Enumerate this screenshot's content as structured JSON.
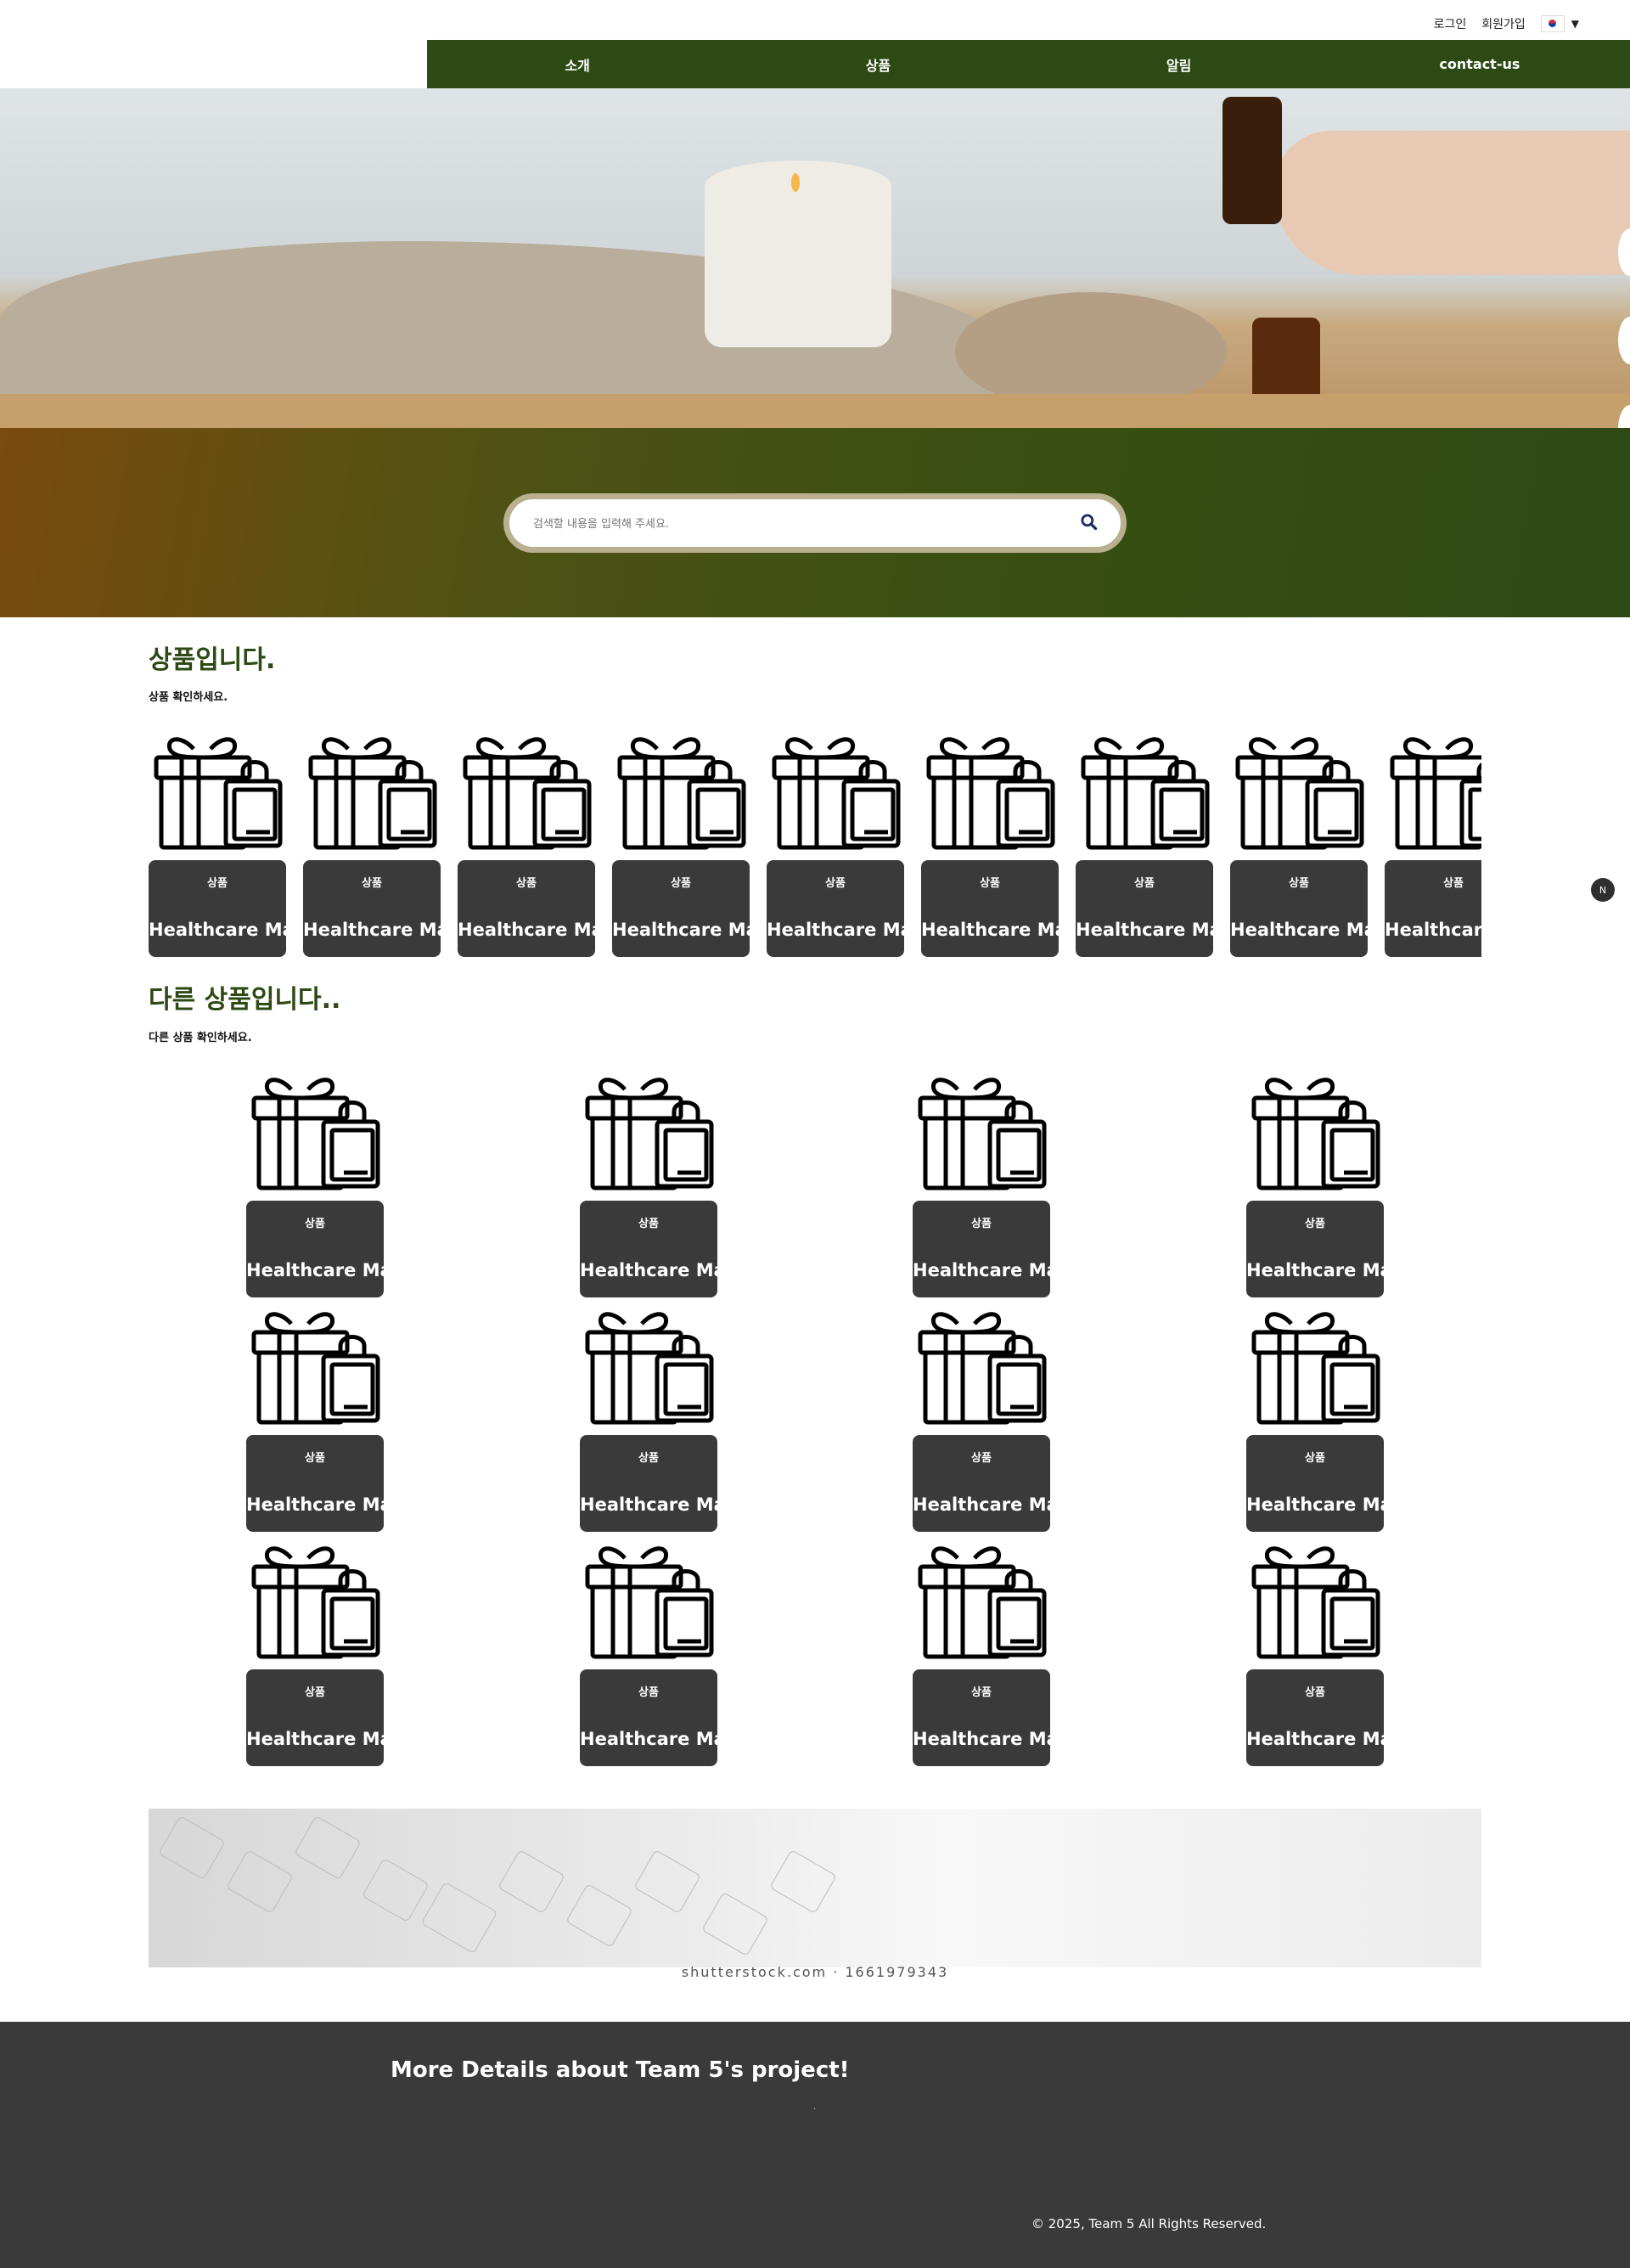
{
  "topbar": {
    "login": "로그인",
    "signup": "회원가입",
    "language_flag_icon": "korea-flag-icon",
    "language_chevron_icon": "chevron-down-icon"
  },
  "nav": {
    "items": [
      "소개",
      "상품",
      "알림",
      "contact-us"
    ]
  },
  "search": {
    "placeholder": "검색할 내용을 입력해 주세요.",
    "icon": "search-icon"
  },
  "section1": {
    "title": "상품입니다.",
    "subtitle": "상품 확인하세요.",
    "products": [
      {
        "category": "상품",
        "name": "Healthcare Mask"
      },
      {
        "category": "상품",
        "name": "Healthcare Mask"
      },
      {
        "category": "상품",
        "name": "Healthcare Mask"
      },
      {
        "category": "상품",
        "name": "Healthcare Mask"
      },
      {
        "category": "상품",
        "name": "Healthcare Mask"
      },
      {
        "category": "상품",
        "name": "Healthcare Mask"
      },
      {
        "category": "상품",
        "name": "Healthcare Mask"
      },
      {
        "category": "상품",
        "name": "Healthcare Mask"
      },
      {
        "category": "상품",
        "name": "Healthcare Mask"
      }
    ]
  },
  "section2": {
    "title": "다른 상품입니다..",
    "subtitle": "다른 상품 확인하세요.",
    "products": [
      {
        "category": "상품",
        "name": "Healthcare Mask"
      },
      {
        "category": "상품",
        "name": "Healthcare Mask"
      },
      {
        "category": "상품",
        "name": "Healthcare Mask"
      },
      {
        "category": "상품",
        "name": "Healthcare Mask"
      },
      {
        "category": "상품",
        "name": "Healthcare Mask"
      },
      {
        "category": "상품",
        "name": "Healthcare Mask"
      },
      {
        "category": "상품",
        "name": "Healthcare Mask"
      },
      {
        "category": "상품",
        "name": "Healthcare Mask"
      },
      {
        "category": "상품",
        "name": "Healthcare Mask"
      },
      {
        "category": "상품",
        "name": "Healthcare Mask"
      },
      {
        "category": "상품",
        "name": "Healthcare Mask"
      },
      {
        "category": "상품",
        "name": "Healthcare Mask"
      }
    ]
  },
  "banner": {
    "watermark": "shutterstock.com · 1661979343"
  },
  "footer": {
    "title": "More Details about Team 5's project!",
    "dot": ".",
    "copyright": "© 2025, Team 5 All Rights Reserved."
  },
  "fab": {
    "label": "N"
  },
  "colors": {
    "nav_green": "#2d4a14",
    "card_dark": "#3a3a3a",
    "footer_dark": "#3a3a3a",
    "title_green": "#2d4a14"
  }
}
